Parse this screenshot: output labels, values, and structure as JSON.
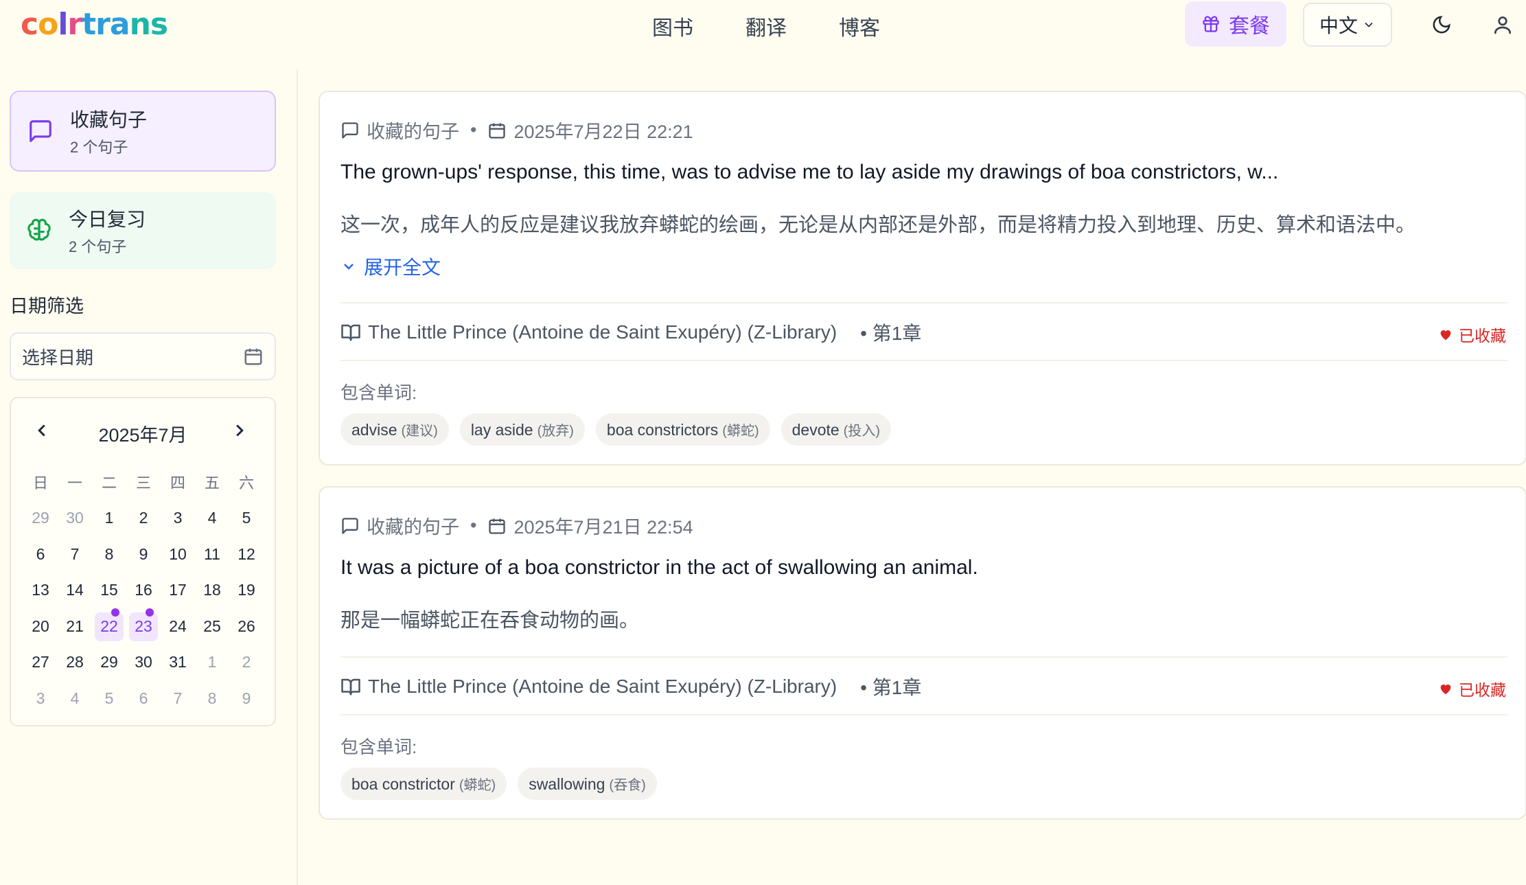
{
  "header": {
    "logo_text": "colrtrans",
    "nav": [
      "图书",
      "翻译",
      "博客"
    ],
    "plan_label": "套餐",
    "language_label": "中文"
  },
  "sidebar": {
    "favorites": {
      "title": "收藏句子",
      "count": "2 个句子"
    },
    "review": {
      "title": "今日复习",
      "count": "2 个句子"
    },
    "filter_label": "日期筛选",
    "date_placeholder": "选择日期",
    "calendar": {
      "title": "2025年7月",
      "weekdays": [
        "日",
        "一",
        "二",
        "三",
        "四",
        "五",
        "六"
      ],
      "days": [
        {
          "d": "29",
          "m": true
        },
        {
          "d": "30",
          "m": true
        },
        {
          "d": "1"
        },
        {
          "d": "2"
        },
        {
          "d": "3"
        },
        {
          "d": "4"
        },
        {
          "d": "5"
        },
        {
          "d": "6"
        },
        {
          "d": "7"
        },
        {
          "d": "8"
        },
        {
          "d": "9"
        },
        {
          "d": "10"
        },
        {
          "d": "11"
        },
        {
          "d": "12"
        },
        {
          "d": "13"
        },
        {
          "d": "14"
        },
        {
          "d": "15"
        },
        {
          "d": "16"
        },
        {
          "d": "17"
        },
        {
          "d": "18"
        },
        {
          "d": "19"
        },
        {
          "d": "20"
        },
        {
          "d": "21"
        },
        {
          "d": "22",
          "mark": true
        },
        {
          "d": "23",
          "mark": true
        },
        {
          "d": "24"
        },
        {
          "d": "25"
        },
        {
          "d": "26"
        },
        {
          "d": "27"
        },
        {
          "d": "28"
        },
        {
          "d": "29"
        },
        {
          "d": "30"
        },
        {
          "d": "31"
        },
        {
          "d": "1",
          "m": true
        },
        {
          "d": "2",
          "m": true
        },
        {
          "d": "3",
          "m": true
        },
        {
          "d": "4",
          "m": true
        },
        {
          "d": "5",
          "m": true
        },
        {
          "d": "6",
          "m": true
        },
        {
          "d": "7",
          "m": true
        },
        {
          "d": "8",
          "m": true
        },
        {
          "d": "9",
          "m": true
        }
      ]
    }
  },
  "cards": [
    {
      "type_label": "收藏的句子",
      "date": "2025年7月22日 22:21",
      "english": "The grown-ups' response, this time, was to advise me to lay aside my drawings of boa constrictors, w...",
      "chinese": "这一次，成年人的反应是建议我放弃蟒蛇的绘画，无论是从内部还是外部，而是将精力投入到地理、历史、算术和语法中。",
      "expand_label": "展开全文",
      "book": "The Little Prince (Antoine de Saint Exupéry) (Z-Library)",
      "chapter": "• 第1章",
      "fav_label": "已收藏",
      "words_label": "包含单词:",
      "words": [
        {
          "w": "advise",
          "t": "(建议)"
        },
        {
          "w": "lay aside",
          "t": "(放弃)"
        },
        {
          "w": "boa constrictors",
          "t": "(蟒蛇)"
        },
        {
          "w": "devote",
          "t": "(投入)"
        }
      ]
    },
    {
      "type_label": "收藏的句子",
      "date": "2025年7月21日 22:54",
      "english": "It was a picture of a boa constrictor in the act of swallowing an animal.",
      "chinese": "那是一幅蟒蛇正在吞食动物的画。",
      "book": "The Little Prince (Antoine de Saint Exupéry) (Z-Library)",
      "chapter": "• 第1章",
      "fav_label": "已收藏",
      "words_label": "包含单词:",
      "words": [
        {
          "w": "boa constrictor",
          "t": "(蟒蛇)"
        },
        {
          "w": "swallowing",
          "t": "(吞食)"
        }
      ]
    }
  ],
  "colors": {
    "accent": "#7c3aed",
    "link": "#2563eb",
    "favorite": "#dc2626",
    "review": "#16a34a"
  }
}
